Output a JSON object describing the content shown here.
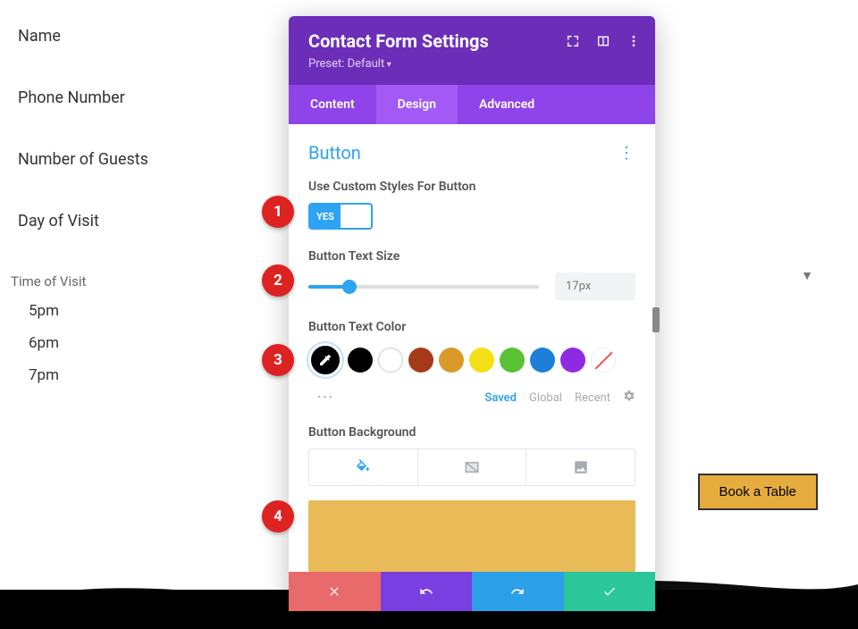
{
  "form": {
    "fields": [
      "Name",
      "Phone Number",
      "Number of Guests",
      "Day of Visit"
    ],
    "time_section_label": "Time of Visit",
    "times": [
      "5pm",
      "6pm",
      "7pm"
    ],
    "cta": "Book a Table"
  },
  "modal": {
    "title": "Contact Form Settings",
    "preset": "Preset: Default",
    "tabs": {
      "content": "Content",
      "design": "Design",
      "advanced": "Advanced"
    },
    "section": "Button",
    "options": {
      "custom_styles_label": "Use Custom Styles For Button",
      "custom_styles_value": "YES",
      "text_size_label": "Button Text Size",
      "text_size_value": "17px",
      "text_color_label": "Button Text Color",
      "background_label": "Button Background"
    },
    "color_tabs": {
      "saved": "Saved",
      "global": "Global",
      "recent": "Recent"
    },
    "swatches": [
      "#000000",
      "#000000",
      "#ffffff",
      "#a53a1a",
      "#d99a2b",
      "#f4e016",
      "#5bc236",
      "#1e7fd6",
      "#8e2be2",
      "none"
    ]
  },
  "badges": {
    "b1": "1",
    "b2": "2",
    "b3": "3",
    "b4": "4"
  }
}
